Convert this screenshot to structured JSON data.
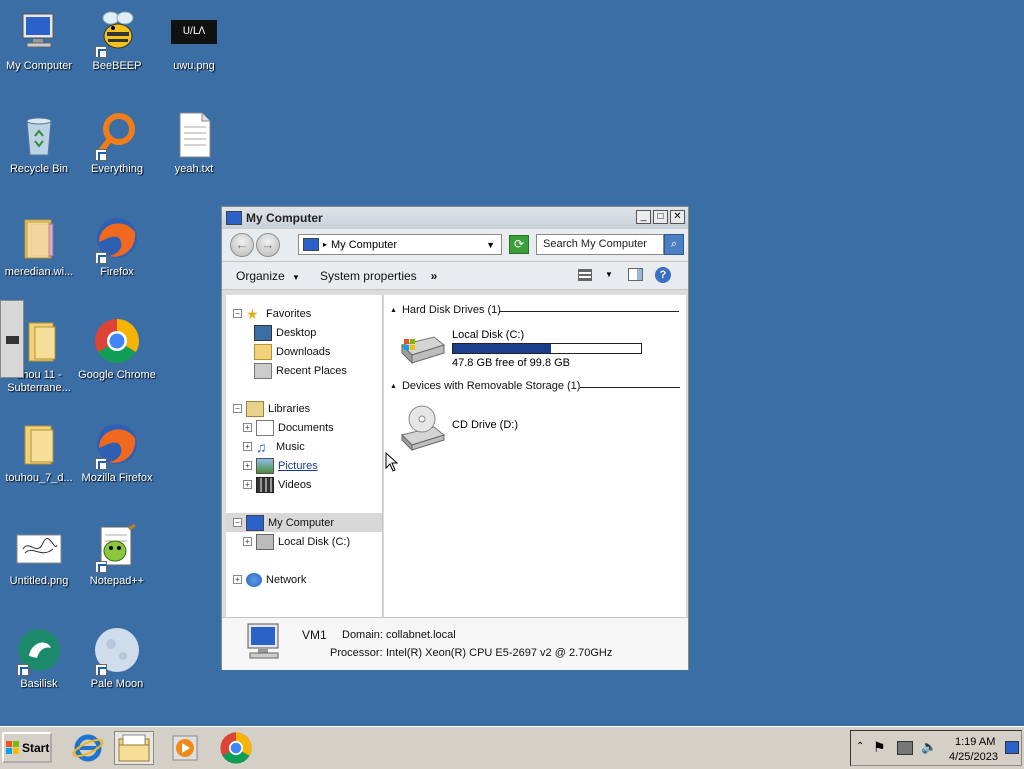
{
  "desktop": {
    "icons": [
      {
        "label": "My Computer"
      },
      {
        "label": "BeeBEEP"
      },
      {
        "label": "uwu.png"
      },
      {
        "label": "Recycle Bin"
      },
      {
        "label": "Everything"
      },
      {
        "label": "yeah.txt"
      },
      {
        "label": "meredian.wi..."
      },
      {
        "label": "Firefox"
      },
      {
        "label": "uhou 11 -\nSubterrane..."
      },
      {
        "label": "Google Chrome"
      },
      {
        "label": "touhou_7_d..."
      },
      {
        "label": "Mozilla Firefox"
      },
      {
        "label": "Untitled.png"
      },
      {
        "label": "Notepad++"
      },
      {
        "label": "Basilisk"
      },
      {
        "label": "Pale Moon"
      }
    ],
    "thumbnail_text": "ᑌ/ᒪᐱ"
  },
  "window": {
    "title": "My Computer",
    "address": "My Computer",
    "search_placeholder": "Search My Computer",
    "toolbar": {
      "organize": "Organize",
      "system_properties": "System properties",
      "more": "»"
    },
    "nav": {
      "favorites": "Favorites",
      "desktop": "Desktop",
      "downloads": "Downloads",
      "recent_places": "Recent Places",
      "libraries": "Libraries",
      "documents": "Documents",
      "music": "Music",
      "pictures": "Pictures",
      "videos": "Videos",
      "my_computer": "My Computer",
      "local_disk": "Local Disk (C:)",
      "network": "Network"
    },
    "content": {
      "hdd_group": "Hard Disk Drives (1)",
      "removable_group": "Devices with Removable Storage (1)",
      "local_disk_name": "Local Disk (C:)",
      "local_disk_free": "47.8 GB free of 99.8 GB",
      "local_disk_used_fraction": 0.52,
      "cd_drive_name": "CD Drive (D:)"
    },
    "details": {
      "computer_name": "VM1",
      "domain_label": "Domain:",
      "domain_value": "collabnet.local",
      "processor_label": "Processor:",
      "processor_value": "Intel(R) Xeon(R) CPU E5-2697 v2 @ 2.70GHz"
    }
  },
  "taskbar": {
    "start_label": "Start",
    "time": "1:19 AM",
    "date": "4/25/2023"
  },
  "colors": {
    "desktop_bg": "#3a6ea5",
    "disk_bar": "#1a3e8c"
  }
}
